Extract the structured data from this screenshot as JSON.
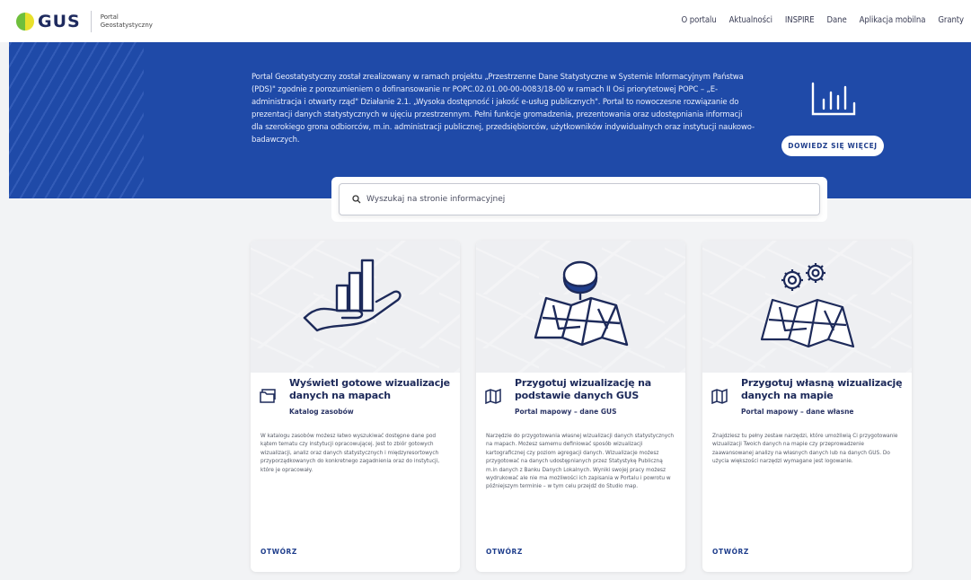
{
  "brand": {
    "name": "GUS",
    "subtitle_line1": "Portal",
    "subtitle_line2": "Geostatystyczny"
  },
  "nav": {
    "items": [
      "O portalu",
      "Aktualności",
      "INSPIRE",
      "Dane",
      "Aplikacja mobilna",
      "Granty"
    ]
  },
  "hero": {
    "text": "Portal Geostatystyczny został zrealizowany w ramach projektu „Przestrzenne Dane Statystyczne w Systemie Informacyjnym Państwa (PDS)\" zgodnie z porozumieniem o dofinansowanie nr POPC.02.01.00-00-0083/18-00 w ramach II Osi priorytetowej POPC – „E-administracja i otwarty rząd\" Działanie 2.1. „Wysoka dostępność i jakość e-usług publicznych\". Portal to nowoczesne rozwiązanie do prezentacji danych statystycznych w ujęciu przestrzennym. Pełni funkcje gromadzenia, prezentowania oraz udostępniania informacji dla szerokiego grona odbiorców, m.in. administracji publicznej, przedsiębiorców, użytkowników indywidualnych oraz instytucji naukowo-badawczych.",
    "button_label": "DOWIEDZ SIĘ WIĘCEJ",
    "icon": "bar-chart-icon"
  },
  "search": {
    "placeholder": "Wyszukaj na stronie informacyjnej",
    "value": ""
  },
  "cards": [
    {
      "title": "Wyświetl gotowe wizualizacje danych na mapach",
      "subtitle": "Katalog zasobów",
      "description": "W katalogu zasobów możesz łatwo wyszukiwać dostępne dane pod kątem tematu czy instytucji opracowującej. Jest to zbiór gotowych wizualizacji, analiz oraz danych statystycznych i międzyresortowych przyporządkowanych do konkretnego zagadnienia oraz do instytucji, które je opracowały.",
      "link": "OTWÓRZ",
      "icon": "folder-icon",
      "art": "hand-chart-icon"
    },
    {
      "title": "Przygotuj wizualizację na podstawie danych GUS",
      "subtitle": "Portal mapowy – dane GUS",
      "description": "Narzędzie do przygotowania własnej wizualizacji danych statystycznych na mapach. Możesz samemu definiować sposób wizualizacji kartograficznej czy poziom agregacji danych. Wizualizacje możesz przygotować na danych udostępnianych przez Statystykę Publiczną m.in danych z Banku Danych Lokalnych. Wyniki swojej pracy możesz wydrukować ale nie ma możliwości ich zapisania w Portalu i powrotu w późniejszym terminie – w tym celu przejdź do Studio map.",
      "link": "OTWÓRZ",
      "icon": "map-icon",
      "art": "map-database-icon"
    },
    {
      "title": "Przygotuj własną wizualizację danych na mapie",
      "subtitle": "Portal mapowy – dane własne",
      "description": "Znajdziesz tu pełny zestaw narzędzi, które umożliwią Ci przygotowanie wizualizacji Twoich danych na mapie czy przeprowadzenie zaawansowanej analizy na własnych danych lub na danych GUS. Do użycia większości narzędzi wymagane jest logowanie.",
      "link": "OTWÓRZ",
      "icon": "map-icon",
      "art": "map-gears-icon"
    }
  ],
  "colors": {
    "primary": "#1f4aa8",
    "navy": "#1d2a5a",
    "page_bg": "#f2f3f5"
  }
}
